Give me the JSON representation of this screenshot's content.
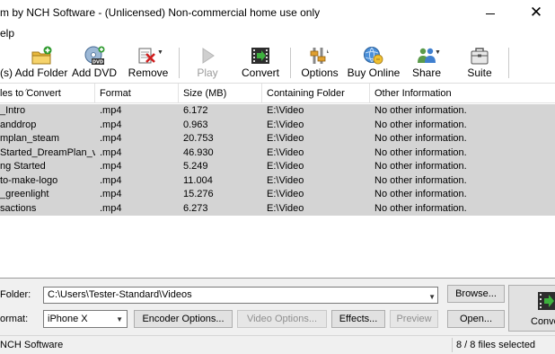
{
  "window": {
    "title": "m by NCH Software - (Unlicensed) Non-commercial home use only",
    "close_glyph": "✕"
  },
  "menu": {
    "help_label": "elp"
  },
  "toolbar": {
    "partial_label": "(s)",
    "add_folder": "Add Folder",
    "add_dvd": "Add DVD",
    "remove": "Remove",
    "play": "Play",
    "convert": "Convert",
    "options": "Options",
    "buy_online": "Buy Online",
    "share": "Share",
    "suite": "Suite",
    "dvd_badge": "DVD"
  },
  "file_list": {
    "columns": {
      "name": "les to Convert",
      "format": "Format",
      "size": "Size (MB)",
      "folder": "Containing Folder",
      "info": "Other Information"
    },
    "rows": [
      {
        "name": "_Intro",
        "format": ".mp4",
        "size": "6.172",
        "folder": "E:\\Video",
        "info": "No other information."
      },
      {
        "name": "anddrop",
        "format": ".mp4",
        "size": "0.963",
        "folder": "E:\\Video",
        "info": "No other information."
      },
      {
        "name": "mplan_steam",
        "format": ".mp4",
        "size": "20.753",
        "folder": "E:\\Video",
        "info": "No other information."
      },
      {
        "name": "Started_DreamPlan_v2",
        "format": ".mp4",
        "size": "46.930",
        "folder": "E:\\Video",
        "info": "No other information."
      },
      {
        "name": "ng Started",
        "format": ".mp4",
        "size": "5.249",
        "folder": "E:\\Video",
        "info": "No other information."
      },
      {
        "name": "to-make-logo",
        "format": ".mp4",
        "size": "11.004",
        "folder": "E:\\Video",
        "info": "No other information."
      },
      {
        "name": "_greenlight",
        "format": ".mp4",
        "size": "15.276",
        "folder": "E:\\Video",
        "info": "No other information."
      },
      {
        "name": "sactions",
        "format": ".mp4",
        "size": "6.273",
        "folder": "E:\\Video",
        "info": "No other information."
      }
    ]
  },
  "output": {
    "folder_label": "Folder:",
    "folder_value": "C:\\Users\\Tester-Standard\\Videos",
    "browse": "Browse...",
    "format_label": "ormat:",
    "format_value": "iPhone X",
    "encoder_options": "Encoder Options...",
    "video_options": "Video Options...",
    "effects": "Effects...",
    "preview": "Preview",
    "open": "Open...",
    "convert": "Conve"
  },
  "status": {
    "left": "NCH Software",
    "right": "8 / 8 files selected"
  }
}
